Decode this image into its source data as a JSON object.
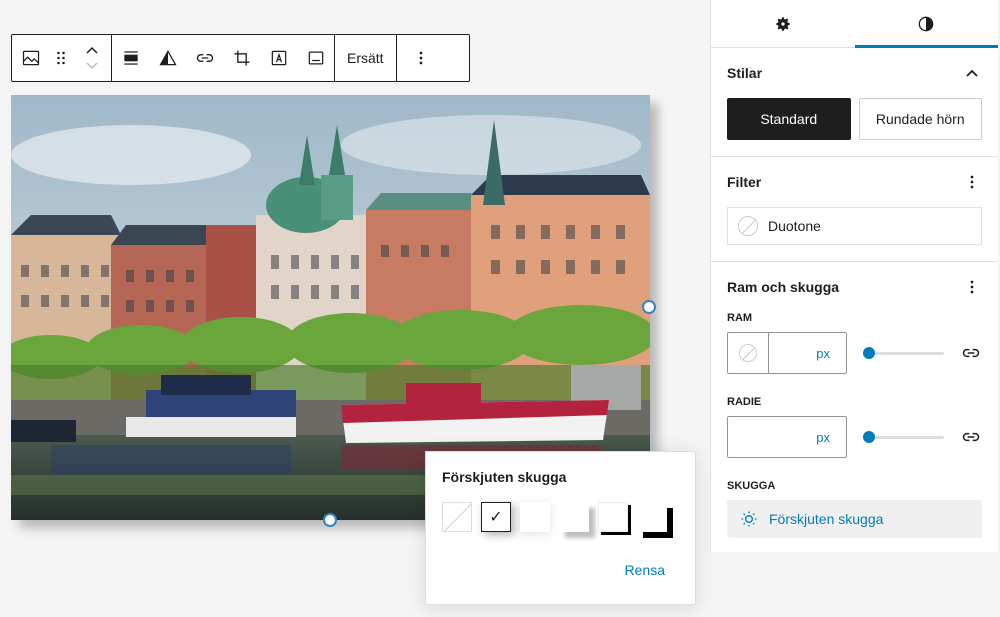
{
  "toolbar": {
    "replace_label": "Ersätt"
  },
  "popover": {
    "title": "Förskjuten skugga",
    "clear_label": "Rensa"
  },
  "sidebar": {
    "styles": {
      "title": "Stilar",
      "options": [
        "Standard",
        "Rundade hörn"
      ]
    },
    "filter": {
      "title": "Filter",
      "duotone_label": "Duotone"
    },
    "border": {
      "title": "Ram och skugga",
      "border_label": "RAM",
      "radius_label": "RADIE",
      "shadow_label": "SKUGGA",
      "unit": "px",
      "shadow_value": "Förskjuten skugga"
    }
  },
  "colors": {
    "accent": "#007cba",
    "dark": "#1e1e1e"
  }
}
